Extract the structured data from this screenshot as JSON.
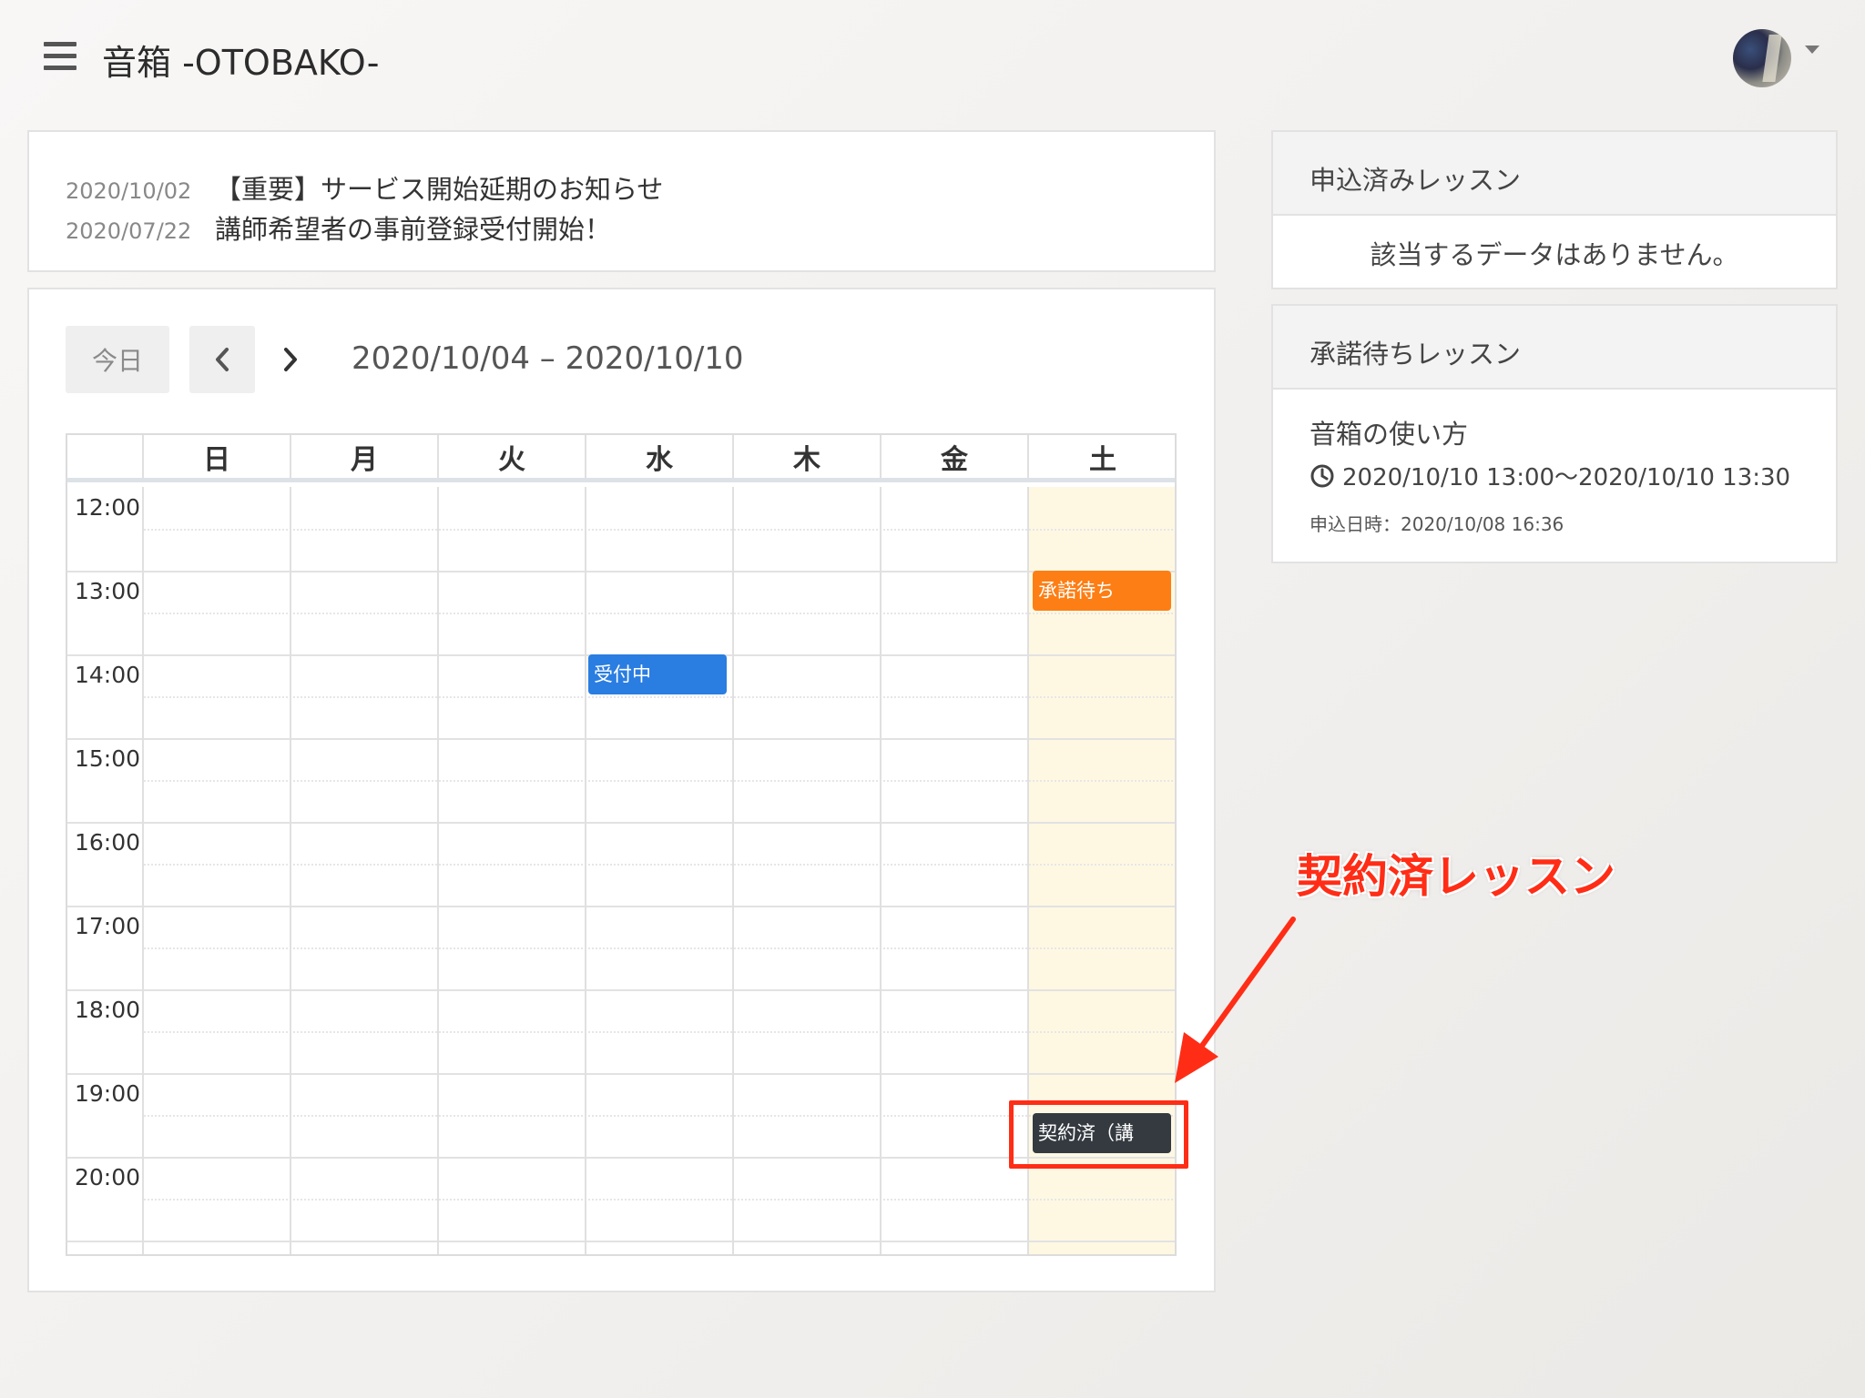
{
  "app": {
    "title": "音箱 -OTOBAKO-"
  },
  "icons": {
    "menu": "hamburger-menu-icon",
    "avatar": "user-avatar",
    "caret": "caret-down-icon",
    "clock": "clock-icon",
    "prev": "chevron-left-icon",
    "next": "chevron-right-icon"
  },
  "news": [
    {
      "date": "2020/10/02",
      "title": "【重要】サービス開始延期のお知らせ"
    },
    {
      "date": "2020/07/22",
      "title": "講師希望者の事前登録受付開始！"
    }
  ],
  "calendar": {
    "today_label": "今日",
    "range": "2020/10/04 – 2020/10/10",
    "days": [
      "日",
      "月",
      "火",
      "水",
      "木",
      "金",
      "土"
    ],
    "hours": [
      "12:00",
      "13:00",
      "14:00",
      "15:00",
      "16:00",
      "17:00",
      "18:00",
      "19:00",
      "20:00"
    ],
    "highlight_day": "土",
    "events": [
      {
        "day": "土",
        "start": "13:00",
        "label": "承諾待ち",
        "color": "#fd7e14"
      },
      {
        "day": "水",
        "start": "14:00",
        "label": "受付中",
        "color": "#2a7de1"
      },
      {
        "day": "土",
        "start": "19:30",
        "label": "契約済（講",
        "color": "#343a40"
      }
    ]
  },
  "applied_panel": {
    "title": "申込済みレッスン",
    "empty_message": "該当するデータはありません。"
  },
  "pending_panel": {
    "title": "承諾待ちレッスン",
    "lesson_name": "音箱の使い方",
    "time_range": "2020/10/10 13:00〜2020/10/10 13:30",
    "applied_at": "申込日時：2020/10/08 16:36"
  },
  "annotation": {
    "text": "契約済レッスン",
    "color": "#ff2d16"
  }
}
